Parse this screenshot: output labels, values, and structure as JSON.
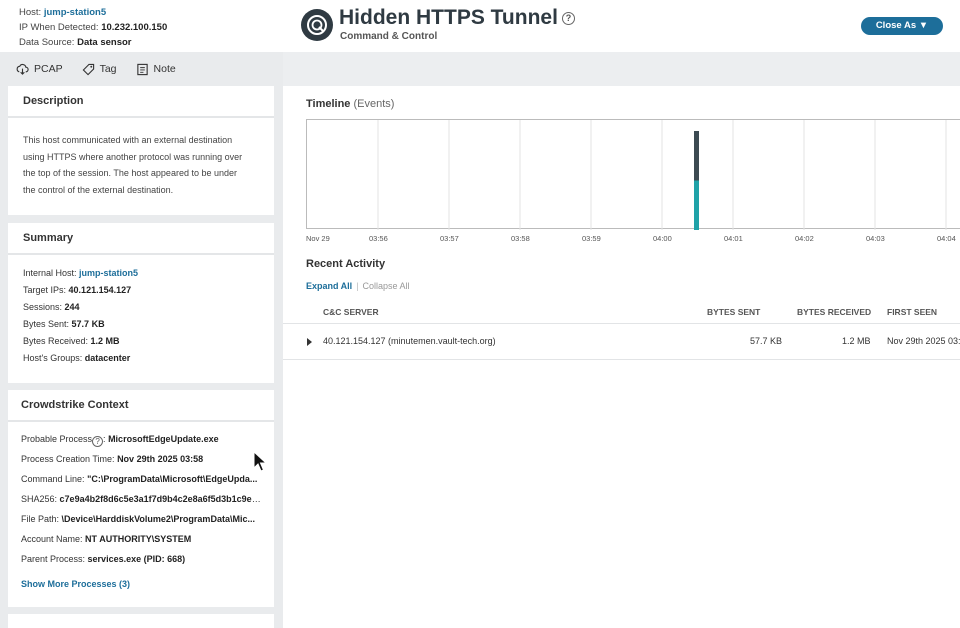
{
  "host_info": {
    "host_label": "Host:",
    "host_value": "jump-station5",
    "ip_label": "IP When Detected:",
    "ip_value": "10.232.100.150",
    "source_label": "Data Source:",
    "source_value": "Data sensor"
  },
  "toolbar": {
    "pcap": "PCAP",
    "tag": "Tag",
    "note": "Note"
  },
  "header": {
    "title": "Hidden HTTPS Tunnel",
    "subtitle": "Command & Control",
    "close_as": "Close As",
    "help": "?"
  },
  "description": {
    "heading": "Description",
    "lines": [
      "This host communicated with an external destination",
      "using HTTPS where another protocol was running over",
      "the top of the session. The host appeared to be under",
      "the control of the external destination."
    ]
  },
  "summary": {
    "heading": "Summary",
    "rows": [
      {
        "label": "Internal Host:",
        "value": "jump-station5"
      },
      {
        "label": "Target IPs:",
        "value": "40.121.154.127"
      },
      {
        "label": "Sessions:",
        "value": "244"
      },
      {
        "label": "Bytes Sent:",
        "value": "57.7 KB"
      },
      {
        "label": "Bytes Received:",
        "value": "1.2 MB"
      },
      {
        "label": "Host's Groups:",
        "value": "datacenter"
      }
    ]
  },
  "crowdstrike": {
    "heading": "Crowdstrike Context",
    "rows": [
      {
        "label": "Probable Process",
        "value": "MicrosoftEdgeUpdate.exe"
      },
      {
        "label": "Process Creation Time:",
        "value": "Nov 29th 2025 03:58"
      },
      {
        "label": "Command Line:",
        "value": "\"C:\\ProgramData\\Microsoft\\EdgeUpda..."
      },
      {
        "label": "SHA256:",
        "value": "c7e9a4b2f8d6c5e3a1f7d9b4c2e8a6f5d3b1c9e7a..."
      },
      {
        "label": "File Path:",
        "value": "\\Device\\HarddiskVolume2\\ProgramData\\Mic..."
      },
      {
        "label": "Account Name:",
        "value": "NT AUTHORITY\\SYSTEM"
      },
      {
        "label": "Parent Process:",
        "value": "services.exe (PID: 668)"
      }
    ],
    "help": "?",
    "show_more": "Show More Processes (3)"
  },
  "timeline": {
    "title": "Timeline",
    "subtitle": "(Events)",
    "ticks": [
      "Nov 29",
      "03:56",
      "03:57",
      "03:58",
      "03:59",
      "04:00",
      "04:01",
      "04:02",
      "04:03",
      "04:04"
    ]
  },
  "chart_data": {
    "type": "bar",
    "title": "Timeline (Events)",
    "x": [
      "Nov 29",
      "03:56",
      "03:57",
      "03:58",
      "03:59",
      "04:00",
      "04:01",
      "04:02",
      "04:03",
      "04:04"
    ],
    "series": [
      {
        "color": "#1fa2a8",
        "values_at": [
          {
            "x": "04:00",
            "fraction_of_height": 0.45
          }
        ]
      },
      {
        "color": "#3c4a52",
        "values_at": [
          {
            "x": "04:00",
            "fraction_of_height": 0.45
          }
        ]
      }
    ],
    "grid": true
  },
  "recent": {
    "title": "Recent Activity",
    "expand_all": "Expand All",
    "separator": "|",
    "collapse_all": "Collapse All",
    "columns": [
      "C&C SERVER",
      "BYTES SENT",
      "BYTES RECEIVED",
      "FIRST SEEN"
    ],
    "rows": [
      {
        "server": "40.121.154.127 (minutemen.vault-tech.org)",
        "sent": "57.7 KB",
        "received": "1.2 MB",
        "first_seen": "Nov 29th 2025 03:"
      }
    ]
  },
  "colors": {
    "accent": "#1d6e9a",
    "teal": "#1fa2a8",
    "dark": "#2f3a42"
  }
}
